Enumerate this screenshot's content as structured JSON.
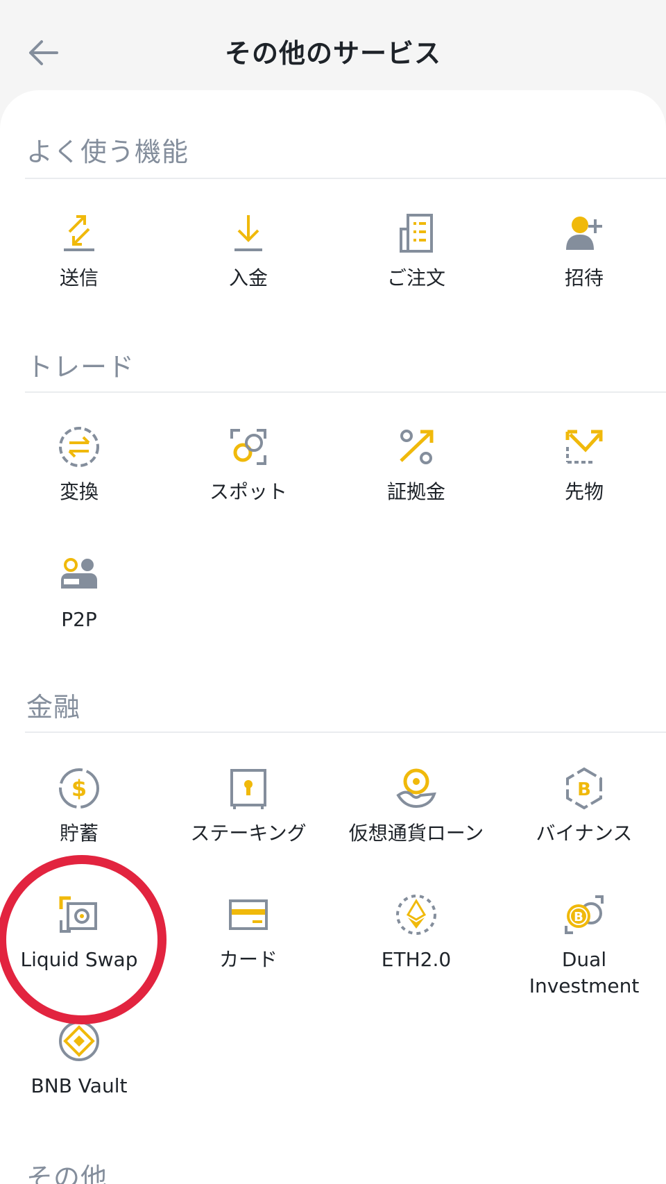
{
  "header": {
    "title": "その他のサービス",
    "back_icon": "arrow-left-icon"
  },
  "colors": {
    "accent": "#f0b90b",
    "icon_gray": "#848e9c",
    "highlight": "#e2243f"
  },
  "sections": [
    {
      "title": "よく使う機能",
      "items": [
        {
          "label": "送信",
          "icon": "send-icon"
        },
        {
          "label": "入金",
          "icon": "deposit-icon"
        },
        {
          "label": "ご注文",
          "icon": "orders-icon"
        },
        {
          "label": "招待",
          "icon": "invite-icon"
        }
      ]
    },
    {
      "title": "トレード",
      "items": [
        {
          "label": "変換",
          "icon": "convert-icon"
        },
        {
          "label": "スポット",
          "icon": "spot-icon"
        },
        {
          "label": "証拠金",
          "icon": "margin-icon"
        },
        {
          "label": "先物",
          "icon": "futures-icon"
        },
        {
          "label": "P2P",
          "icon": "p2p-icon"
        }
      ]
    },
    {
      "title": "金融",
      "items": [
        {
          "label": "貯蓄",
          "icon": "savings-icon"
        },
        {
          "label": "ステーキング",
          "icon": "staking-icon"
        },
        {
          "label": "仮想通貨ローン",
          "icon": "crypto-loan-icon"
        },
        {
          "label": "バイナンス",
          "icon": "binance-pool-icon"
        },
        {
          "label": "Liquid Swap",
          "icon": "liquid-swap-icon"
        },
        {
          "label": "カード",
          "icon": "card-icon"
        },
        {
          "label": "ETH2.0",
          "icon": "eth-icon"
        },
        {
          "label": "Dual\nInvestment",
          "icon": "dual-investment-icon"
        },
        {
          "label": "BNB Vault",
          "icon": "bnb-vault-icon"
        }
      ]
    },
    {
      "title": "その他"
    }
  ]
}
